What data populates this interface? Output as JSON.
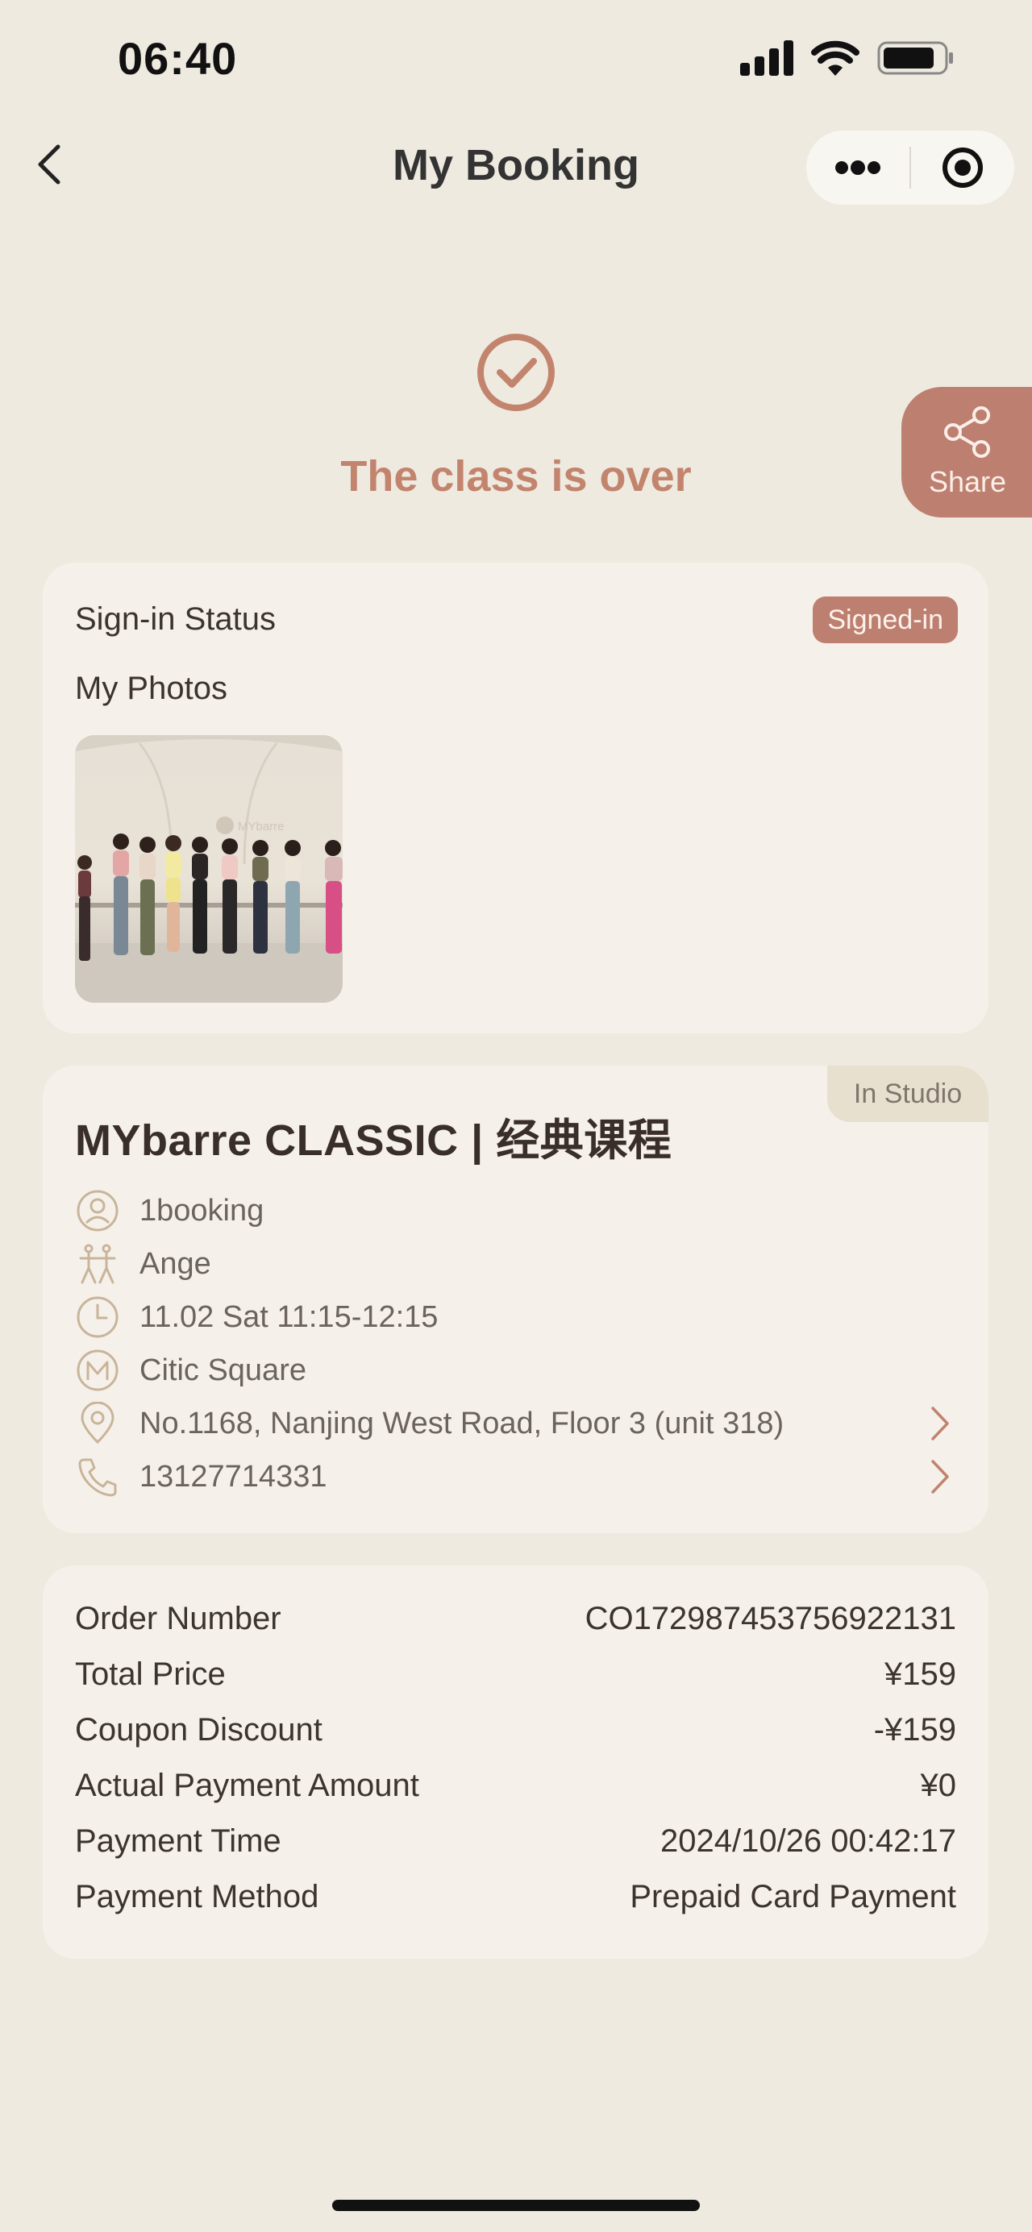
{
  "status_bar": {
    "time": "06:40"
  },
  "nav": {
    "title": "My Booking"
  },
  "hero": {
    "message": "The class is over"
  },
  "share": {
    "label": "Share"
  },
  "signin": {
    "label": "Sign-in Status",
    "badge": "Signed-in",
    "photos_label": "My Photos",
    "photo_watermark": "MYbarre"
  },
  "class": {
    "mode_tag": "In Studio",
    "title": "MYbarre CLASSIC | 经典课程",
    "booking": "1booking",
    "instructor": "Ange",
    "time": "11.02 Sat 11:15-12:15",
    "studio": "Citic Square",
    "address": "No.1168, Nanjing West Road, Floor 3 (unit 318)",
    "phone": "13127714331"
  },
  "payment": {
    "rows": [
      {
        "label": "Order Number",
        "value": "CO172987453756922131"
      },
      {
        "label": "Total Price",
        "value": "¥159"
      },
      {
        "label": "Coupon Discount",
        "value": "-¥159"
      },
      {
        "label": "Actual Payment Amount",
        "value": "¥0"
      },
      {
        "label": "Payment Time",
        "value": "2024/10/26 00:42:17"
      },
      {
        "label": "Payment Method",
        "value": "Prepaid Card Payment"
      }
    ]
  },
  "colors": {
    "background": "#eeeae0",
    "card": "#f5f1ea",
    "accent": "#bd8070",
    "hero_text": "#c3846e"
  },
  "icons": [
    "signal-icon",
    "wifi-icon",
    "battery-icon",
    "back-arrow-icon",
    "more-dots-icon",
    "record-target-icon",
    "check-circle-icon",
    "share-icon",
    "user-icon",
    "dancer-icon",
    "clock-icon",
    "studio-logo-icon",
    "location-pin-icon",
    "phone-icon",
    "chevron-right-icon"
  ]
}
